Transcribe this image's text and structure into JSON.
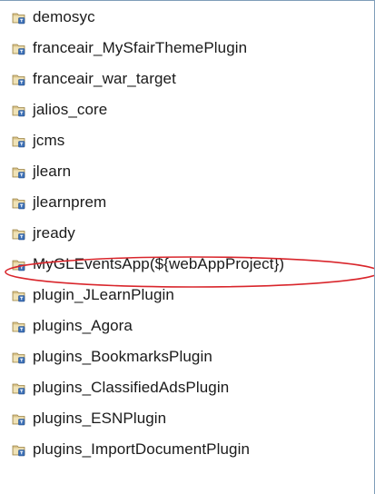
{
  "explorer": {
    "items": [
      {
        "label": "demosyc",
        "icon": "java-project-icon"
      },
      {
        "label": "franceair_MySfairThemePlugin",
        "icon": "java-project-icon"
      },
      {
        "label": "franceair_war_target",
        "icon": "java-project-icon"
      },
      {
        "label": "jalios_core",
        "icon": "java-project-icon"
      },
      {
        "label": "jcms",
        "icon": "java-project-icon"
      },
      {
        "label": "jlearn",
        "icon": "java-project-icon"
      },
      {
        "label": "jlearnprem",
        "icon": "java-project-icon"
      },
      {
        "label": "jready",
        "icon": "java-project-icon"
      },
      {
        "label": "MyGLEventsApp(${webAppProject})",
        "icon": "java-project-icon",
        "highlighted": true
      },
      {
        "label": "plugin_JLearnPlugin",
        "icon": "java-project-icon"
      },
      {
        "label": "plugins_Agora",
        "icon": "java-project-icon"
      },
      {
        "label": "plugins_BookmarksPlugin",
        "icon": "java-project-icon"
      },
      {
        "label": "plugins_ClassifiedAdsPlugin",
        "icon": "java-project-icon"
      },
      {
        "label": "plugins_ESNPlugin",
        "icon": "java-project-icon"
      },
      {
        "label": "plugins_ImportDocumentPlugin",
        "icon": "java-project-icon"
      }
    ]
  },
  "colors": {
    "highlight_ring": "#d9262c",
    "icon_folder": "#d8c28a",
    "icon_badge": "#3b6fb6",
    "text": "#1a1a1a"
  }
}
